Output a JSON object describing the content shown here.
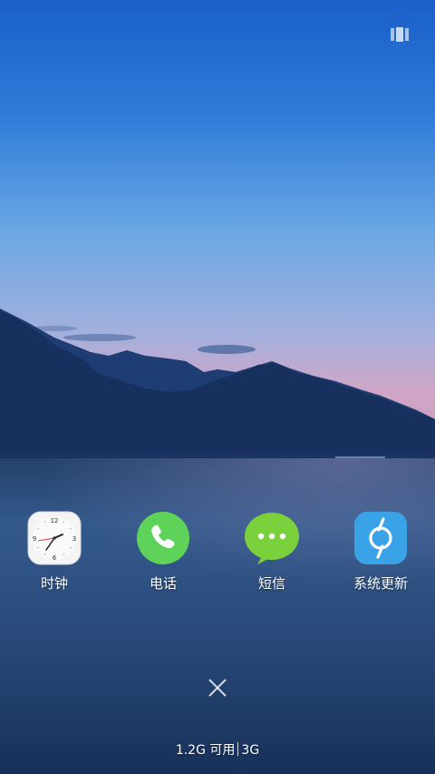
{
  "apps": [
    {
      "label": "时钟",
      "icon": "clock-icon"
    },
    {
      "label": "电话",
      "icon": "phone-icon"
    },
    {
      "label": "短信",
      "icon": "message-icon"
    },
    {
      "label": "系统更新",
      "icon": "system-update-icon"
    }
  ],
  "status": {
    "memory": "1.2G 可用",
    "network": "3G"
  },
  "clock": {
    "numerals": [
      "12",
      "3",
      "6",
      "9"
    ]
  },
  "colors": {
    "phone_green": "#5fd25a",
    "message_green": "#7bd13c",
    "update_blue": "#3aa2e6",
    "clock_face": "#f4f4f4"
  }
}
